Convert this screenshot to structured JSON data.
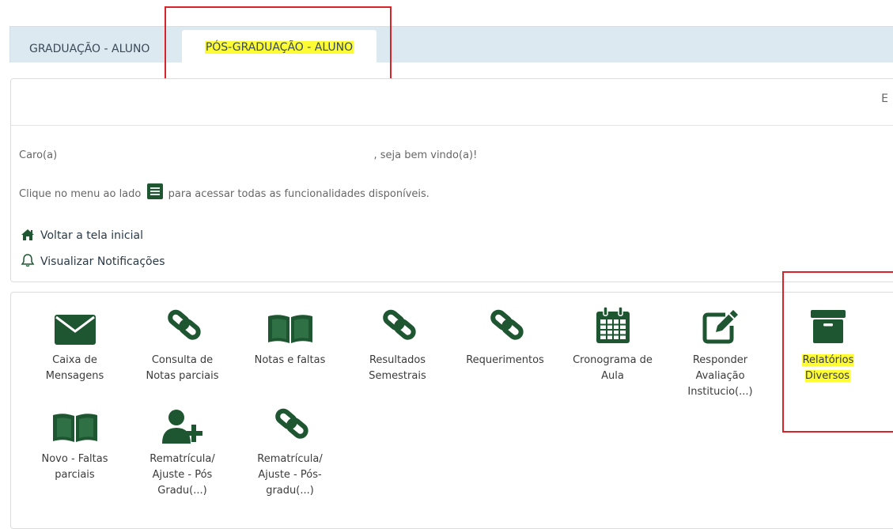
{
  "colors": {
    "accent_green": "#1e5631",
    "tab_bar": "#dde9f1",
    "highlight": "#fdfc34",
    "annotation_red": "#d8232a"
  },
  "tabs": [
    {
      "label": "GRADUAÇÃO - ALUNO",
      "active": false
    },
    {
      "label": "PÓS-GRADUAÇÃO - ALUNO",
      "active": true
    }
  ],
  "header": {
    "cut_text": "E"
  },
  "welcome": {
    "greeting_prefix": "Caro(a)",
    "greeting_suffix": ", seja bem vindo(a)!",
    "menu_hint_before": "Clique no menu ao lado",
    "menu_hint_after": "para acessar todas as funcionalidades disponíveis."
  },
  "links": {
    "home": "Voltar a tela inicial",
    "notifications": "Visualizar Notificações"
  },
  "tiles": [
    {
      "icon": "envelope-icon",
      "label": "Caixa de Mensagens"
    },
    {
      "icon": "link-icon",
      "label": "Consulta de Notas parciais"
    },
    {
      "icon": "book-icon",
      "label": "Notas e faltas"
    },
    {
      "icon": "link-icon",
      "label": "Resultados Semestrais"
    },
    {
      "icon": "link-icon",
      "label": "Requerimentos"
    },
    {
      "icon": "calendar-icon",
      "label": "Cronograma de Aula"
    },
    {
      "icon": "edit-icon",
      "label": "Responder Avaliação Institucio(...)"
    },
    {
      "icon": "archive-icon",
      "label": "Relatórios Diversos"
    },
    {
      "icon": "book-icon",
      "label": "Novo - Faltas parciais"
    },
    {
      "icon": "user-plus-icon",
      "label": "Rematrícula/ Ajuste - Pós Gradu(...)"
    },
    {
      "icon": "link-icon",
      "label": "Rematrícula/ Ajuste - Pós-gradu(...)"
    }
  ]
}
